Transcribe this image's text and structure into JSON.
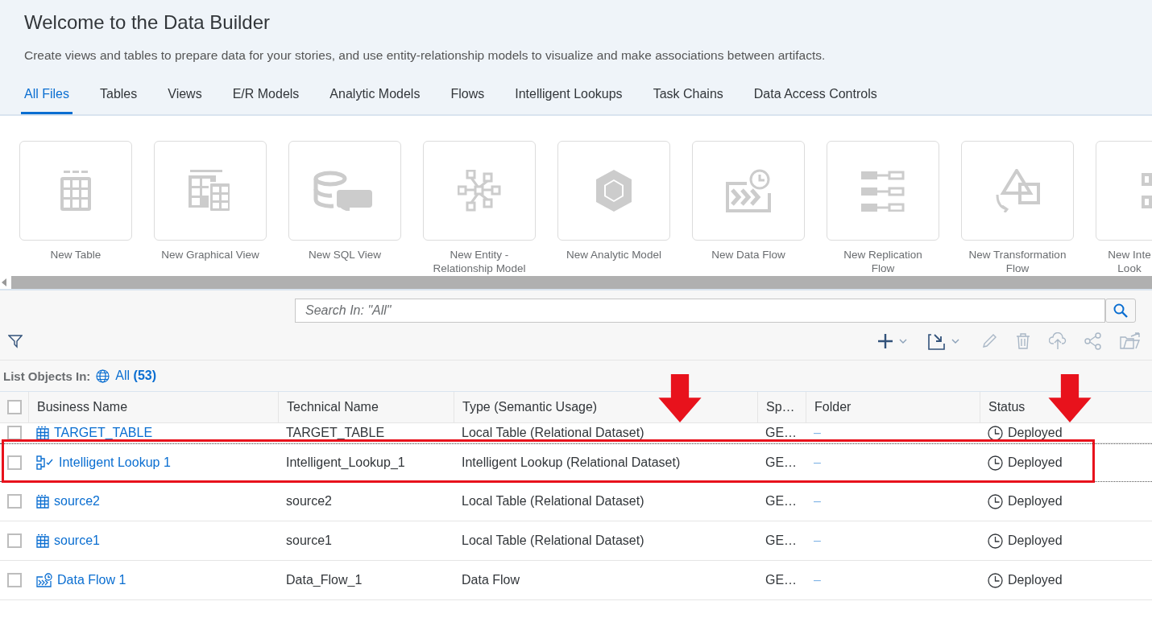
{
  "page": {
    "title": "Welcome to the Data Builder",
    "subtitle": "Create views and tables to prepare data for your stories, and use entity-relationship models to visualize and make associations between artifacts."
  },
  "tabs": [
    {
      "label": "All Files",
      "selected": true
    },
    {
      "label": "Tables",
      "selected": false
    },
    {
      "label": "Views",
      "selected": false
    },
    {
      "label": "E/R Models",
      "selected": false
    },
    {
      "label": "Analytic Models",
      "selected": false
    },
    {
      "label": "Flows",
      "selected": false
    },
    {
      "label": "Intelligent Lookups",
      "selected": false
    },
    {
      "label": "Task Chains",
      "selected": false
    },
    {
      "label": "Data Access Controls",
      "selected": false
    }
  ],
  "tiles": [
    {
      "kind": "table",
      "lines": [
        "New Table"
      ]
    },
    {
      "kind": "graphical-view",
      "lines": [
        "New Graphical View"
      ]
    },
    {
      "kind": "sql",
      "lines": [
        "New SQL View"
      ]
    },
    {
      "kind": "er",
      "lines": [
        "New Entity -",
        "Relationship Model"
      ]
    },
    {
      "kind": "analytic",
      "lines": [
        "New Analytic Model"
      ]
    },
    {
      "kind": "dataflow",
      "lines": [
        "New Data Flow"
      ]
    },
    {
      "kind": "replication",
      "lines": [
        "New Replication",
        "Flow"
      ]
    },
    {
      "kind": "transformation",
      "lines": [
        "New Transformation",
        "Flow"
      ]
    },
    {
      "kind": "lookup",
      "lines": [
        "New Inte",
        "Look"
      ],
      "cut": true
    }
  ],
  "search": {
    "placeholder": "Search In: \"All\""
  },
  "list_scope": {
    "label": "List Objects In:",
    "value": "All",
    "count": "(53)"
  },
  "table": {
    "select_all_checked": false,
    "columns": [
      {
        "label": "Business Name",
        "arrow": false
      },
      {
        "label": "Technical Name",
        "arrow": false
      },
      {
        "label": "Type (Semantic Usage)",
        "arrow": true
      },
      {
        "label": "Sp…",
        "arrow": false
      },
      {
        "label": "Folder",
        "arrow": false
      },
      {
        "label": "Status",
        "arrow": true
      }
    ],
    "rows": [
      {
        "kind": "table",
        "business_name": "TARGET_TABLE",
        "technical_name": "TARGET_TABLE",
        "type": "Local Table (Relational Dataset)",
        "space": "GE…",
        "folder": "–",
        "status": "Deployed",
        "checked": false,
        "highlighted": false,
        "partial": true
      },
      {
        "kind": "lookup",
        "business_name": "Intelligent Lookup 1",
        "technical_name": "Intelligent_Lookup_1",
        "type": "Intelligent Lookup (Relational Dataset)",
        "space": "GE…",
        "folder": "–",
        "status": "Deployed",
        "checked": false,
        "highlighted": true,
        "partial": false
      },
      {
        "kind": "table",
        "business_name": "source2",
        "technical_name": "source2",
        "type": "Local Table (Relational Dataset)",
        "space": "GE…",
        "folder": "–",
        "status": "Deployed",
        "checked": false,
        "highlighted": false,
        "partial": false
      },
      {
        "kind": "table",
        "business_name": "source1",
        "technical_name": "source1",
        "type": "Local Table (Relational Dataset)",
        "space": "GE…",
        "folder": "–",
        "status": "Deployed",
        "checked": false,
        "highlighted": false,
        "partial": false
      },
      {
        "kind": "dataflow",
        "business_name": "Data Flow 1",
        "technical_name": "Data_Flow_1",
        "type": "Data Flow",
        "space": "GE…",
        "folder": "–",
        "status": "Deployed",
        "checked": false,
        "highlighted": false,
        "partial": false
      }
    ]
  }
}
